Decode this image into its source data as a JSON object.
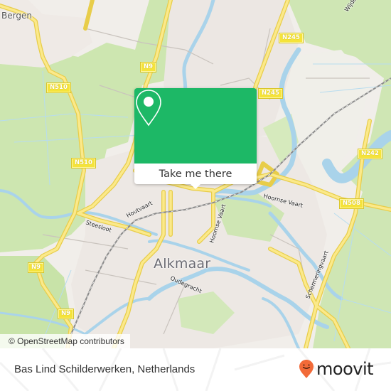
{
  "map": {
    "city_labels": [
      {
        "name": "Bergen",
        "kind": "small"
      },
      {
        "name": "Alkmaar",
        "kind": "big"
      }
    ],
    "street_labels": [
      "Houtvaart",
      "Steesloot",
      "Hoornse Vaart",
      "Hoornse Vaart",
      "Oudegracht",
      "Schermeringvaart",
      "Wijde"
    ],
    "road_shields": [
      "N9",
      "N9",
      "N9",
      "N510",
      "N510",
      "N245",
      "N245",
      "N242",
      "N508"
    ],
    "colors": {
      "land": "#f1eeea",
      "farmland": "#c8e4a8",
      "water": "#aad4ea",
      "road_major": "#f8e35b",
      "railway": "#888888"
    }
  },
  "popup": {
    "icon": "map-pin-icon",
    "action_label": "Take me there",
    "accent_color": "#1db866"
  },
  "attribution": "© OpenStreetMap contributors",
  "footer": {
    "place_name": "Bas Lind Schilderwerken, Netherlands",
    "brand": "moovit",
    "brand_icon": "moovit-smile-pin-icon",
    "brand_color": "#f26a38"
  }
}
